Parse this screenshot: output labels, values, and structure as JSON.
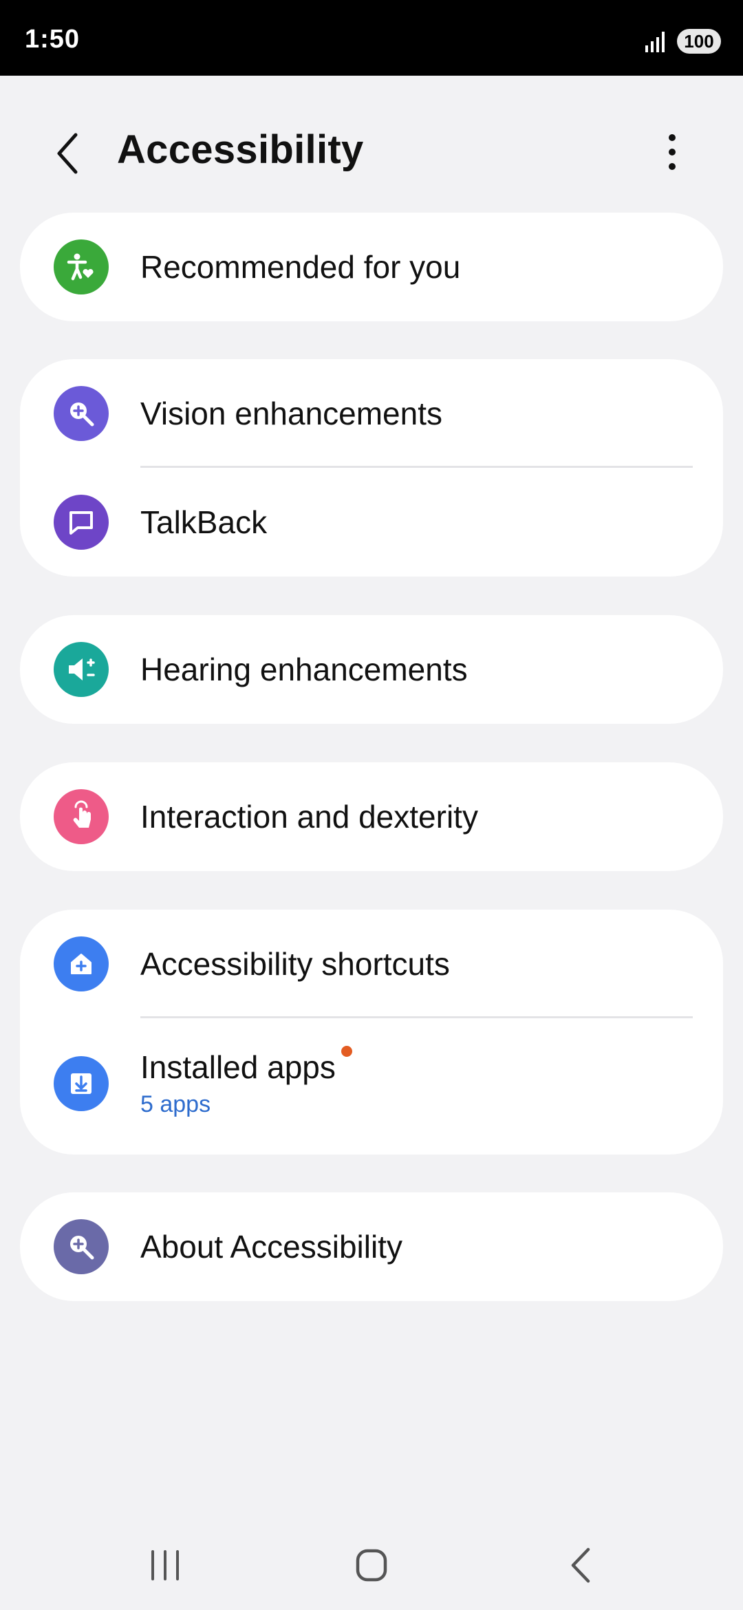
{
  "status_bar": {
    "time": "1:50",
    "battery": "100"
  },
  "header": {
    "title": "Accessibility"
  },
  "items": {
    "recommended": {
      "label": "Recommended for you",
      "icon": "accessibility-person-icon",
      "color": "#3aa93a"
    },
    "vision": {
      "label": "Vision enhancements",
      "icon": "magnifier-plus-icon",
      "color": "#6b5ad8"
    },
    "talkback": {
      "label": "TalkBack",
      "icon": "chat-bubble-icon",
      "color": "#6e45c7"
    },
    "hearing": {
      "label": "Hearing enhancements",
      "icon": "speaker-plus-minus-icon",
      "color": "#1aa89a"
    },
    "interaction": {
      "label": "Interaction and dexterity",
      "icon": "hand-pointer-icon",
      "color": "#ee5b88"
    },
    "shortcuts": {
      "label": "Accessibility shortcuts",
      "icon": "home-plus-icon",
      "color": "#3d7ef0"
    },
    "installed": {
      "label": "Installed apps",
      "sublabel": "5 apps",
      "icon": "download-icon",
      "color": "#3d7ef0",
      "has_new_badge": true
    },
    "about": {
      "label": "About Accessibility",
      "icon": "magnifier-plus-icon",
      "color": "#6a6aa8"
    }
  }
}
